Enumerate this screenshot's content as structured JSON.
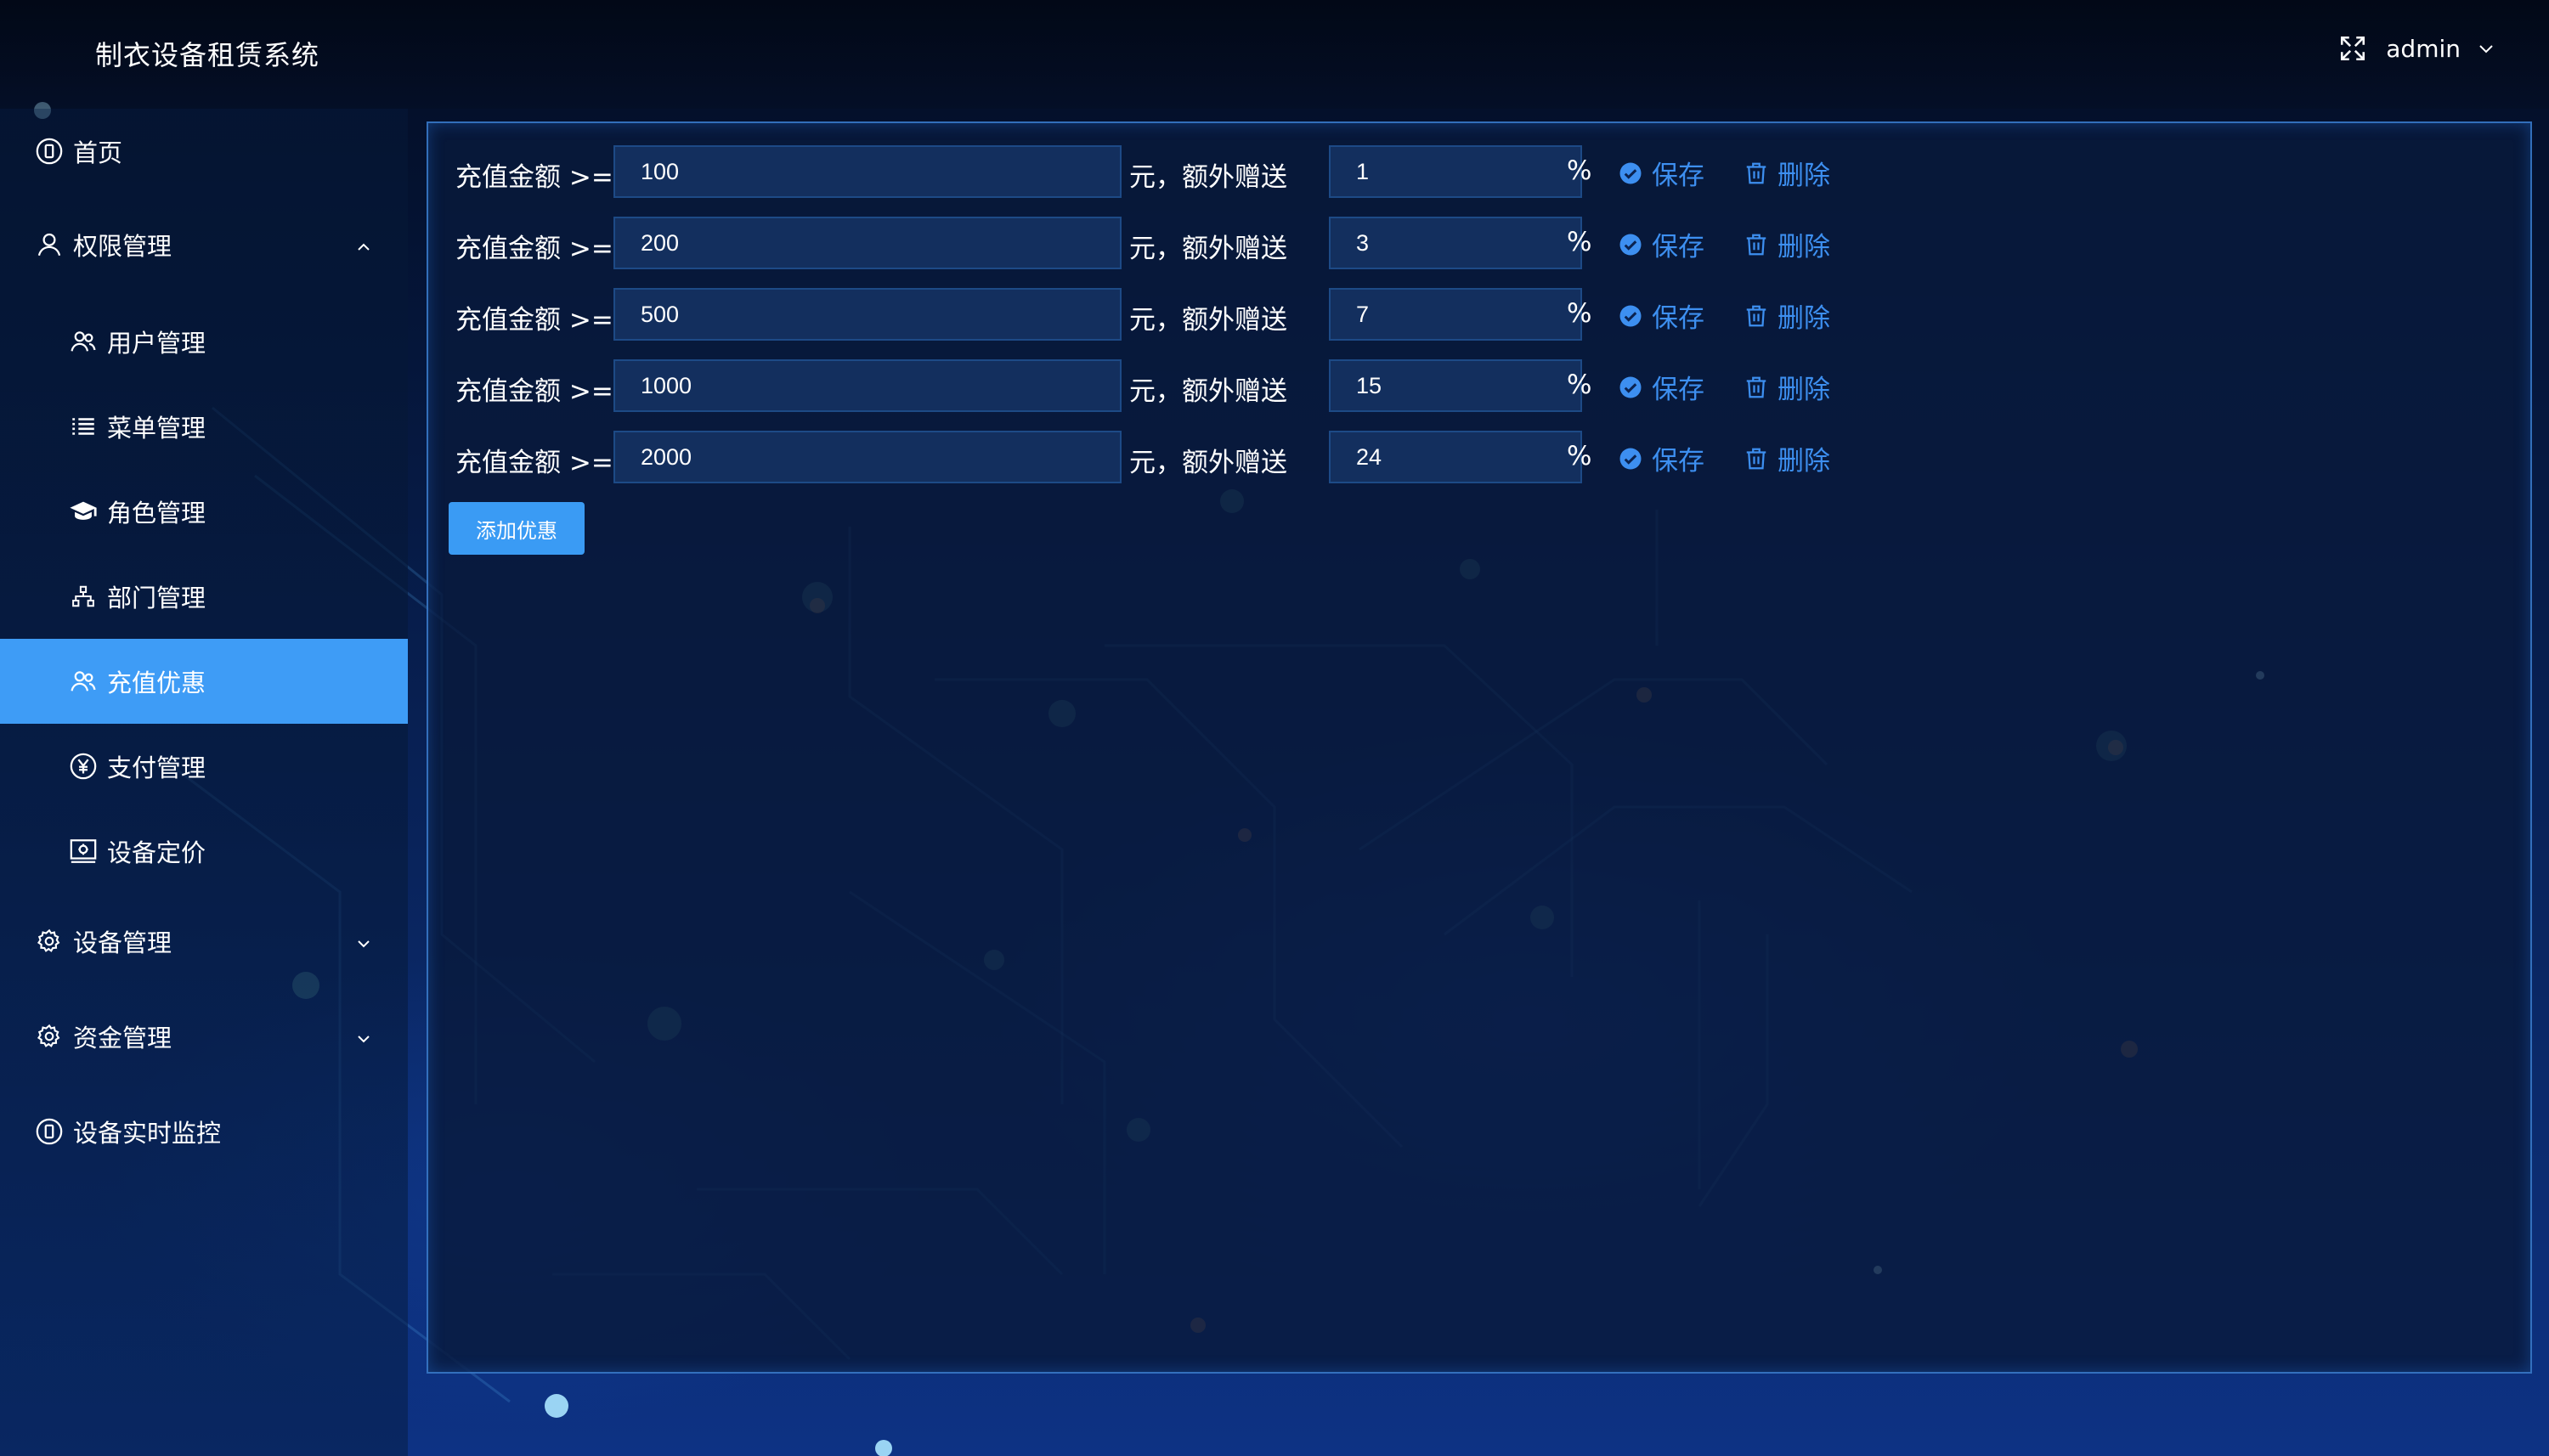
{
  "header": {
    "app_title": "制衣设备租赁系统",
    "username": "admin"
  },
  "sidebar": {
    "items": [
      {
        "label": "首页",
        "icon": "tablet-icon",
        "level": 1
      },
      {
        "label": "权限管理",
        "icon": "user-icon",
        "level": 1,
        "expanded": true
      },
      {
        "label": "用户管理",
        "icon": "users-icon",
        "level": 2
      },
      {
        "label": "菜单管理",
        "icon": "list-icon",
        "level": 2
      },
      {
        "label": "角色管理",
        "icon": "graduation-cap-icon",
        "level": 2
      },
      {
        "label": "部门管理",
        "icon": "org-chart-icon",
        "level": 2
      },
      {
        "label": "充值优惠",
        "icon": "users-icon",
        "level": 2,
        "active": true
      },
      {
        "label": "支付管理",
        "icon": "yen-icon",
        "level": 2
      },
      {
        "label": "设备定价",
        "icon": "price-board-icon",
        "level": 2
      },
      {
        "label": "设备管理",
        "icon": "gear-icon",
        "level": 1,
        "expanded": false
      },
      {
        "label": "资金管理",
        "icon": "gear-icon",
        "level": 1,
        "expanded": false
      },
      {
        "label": "设备实时监控",
        "icon": "tablet-icon",
        "level": 1
      }
    ]
  },
  "recharge": {
    "prefix_label": "充值金额 >=",
    "mid_label": "元，额外赠送",
    "unit_label": "%",
    "save_label": "保存",
    "delete_label": "删除",
    "rules": [
      {
        "amount": "100",
        "bonus": "1"
      },
      {
        "amount": "200",
        "bonus": "3"
      },
      {
        "amount": "500",
        "bonus": "7"
      },
      {
        "amount": "1000",
        "bonus": "15"
      },
      {
        "amount": "2000",
        "bonus": "24"
      }
    ],
    "add_label": "添加优惠"
  },
  "colors": {
    "accent": "#3e9cf6",
    "link": "#3d8ff0",
    "input_bg": "#132f5e",
    "panel_border": "#428ce6"
  }
}
